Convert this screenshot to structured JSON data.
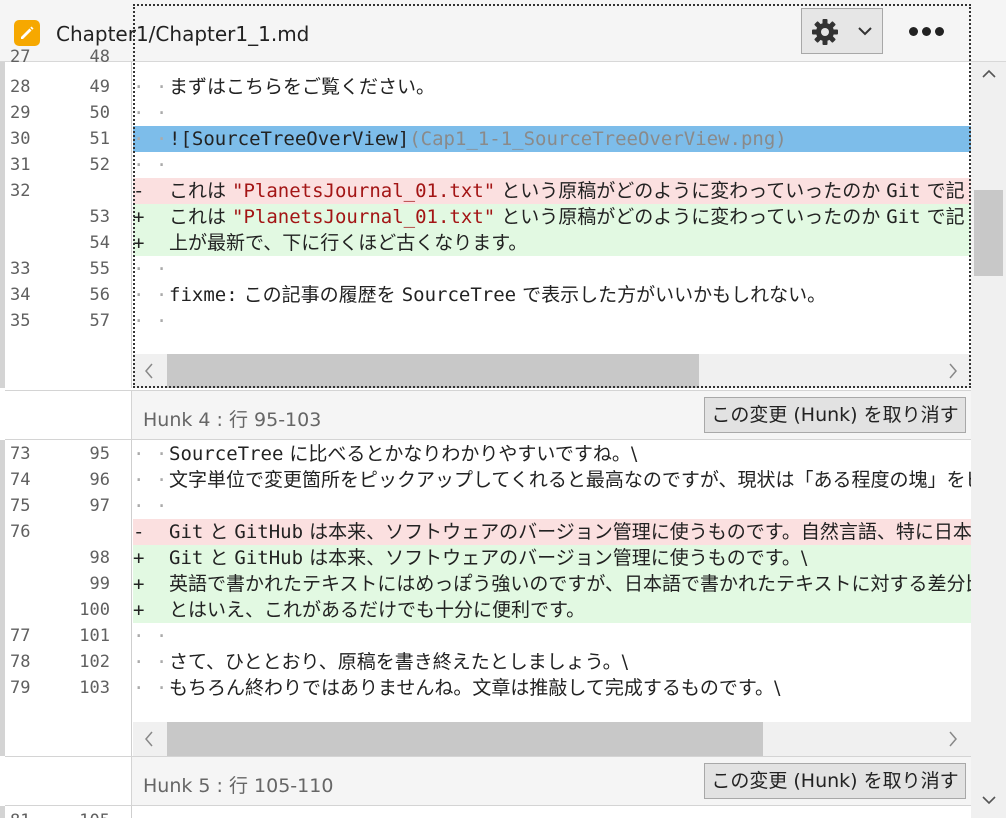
{
  "header": {
    "title": "Chapter1/Chapter1_1.md",
    "file_icon": "pencil-icon",
    "settings_icon": "gear-icon",
    "settings_dropdown_icon": "chevron-down-icon",
    "more_icon": "more-horizontal-icon"
  },
  "colors": {
    "deleted_line": "#fbe0e0",
    "added_line": "#e2f9e2",
    "selected_line": "#7dbdea",
    "file_icon": "#f6a800"
  },
  "hunk1": {
    "partial_top": {
      "old": "27",
      "new": "48"
    },
    "lines": [
      {
        "old": "28",
        "new": "49",
        "marker": "· ·",
        "segments": [
          {
            "t": "まずはこちらをご覧ください。"
          }
        ]
      },
      {
        "old": "29",
        "new": "50",
        "marker": "· ·",
        "segments": []
      },
      {
        "old": "30",
        "new": "51",
        "marker": "· ·",
        "kind": "sel",
        "segments": [
          {
            "t": "![SourceTreeOverView]",
            "c": "mono"
          },
          {
            "t": "(Cap1_1-1_SourceTreeOverView.png)",
            "c": "mono lnk"
          }
        ]
      },
      {
        "old": "31",
        "new": "52",
        "marker": "· ·",
        "segments": []
      },
      {
        "old": "32",
        "new": "",
        "marker": "-",
        "kind": "del",
        "segments": [
          {
            "t": "これは "
          },
          {
            "t": "\"PlanetsJournal_01.txt\"",
            "c": "mono str"
          },
          {
            "t": " という原稿がどのように変わっていったのか "
          },
          {
            "t": "Git",
            "c": "mono"
          },
          {
            "t": " で記"
          }
        ]
      },
      {
        "old": "",
        "new": "53",
        "marker": "+",
        "kind": "add",
        "segments": [
          {
            "t": "これは "
          },
          {
            "t": "\"PlanetsJournal_01.txt\"",
            "c": "mono str"
          },
          {
            "t": " という原稿がどのように変わっていったのか "
          },
          {
            "t": "Git",
            "c": "mono"
          },
          {
            "t": " で記"
          }
        ]
      },
      {
        "old": "",
        "new": "54",
        "marker": "+",
        "kind": "add",
        "segments": [
          {
            "t": "上が最新で、下に行くほど古くなります。"
          }
        ]
      },
      {
        "old": "33",
        "new": "55",
        "marker": "· ·",
        "segments": []
      },
      {
        "old": "34",
        "new": "56",
        "marker": "· ·",
        "segments": [
          {
            "t": "fixme:",
            "c": "mono"
          },
          {
            "t": " この記事の履歴を "
          },
          {
            "t": "SourceTree",
            "c": "mono"
          },
          {
            "t": " で表示した方がいいかもしれない。"
          }
        ]
      },
      {
        "old": "35",
        "new": "57",
        "marker": "· ·",
        "segments": []
      }
    ]
  },
  "hunk4": {
    "label": "Hunk 4 : 行 95-103",
    "revert_label": "この変更 (Hunk) を取り消す",
    "lines": [
      {
        "old": "73",
        "new": "95",
        "marker": "· ·",
        "segments": [
          {
            "t": "SourceTree",
            "c": "mono"
          },
          {
            "t": " に比べるとかなりわかりやすいですね。\\"
          }
        ]
      },
      {
        "old": "74",
        "new": "96",
        "marker": "· ·",
        "segments": [
          {
            "t": "文字単位で変更箇所をピックアップしてくれると最高なのですが、現状は「ある程度の塊」をピッ"
          }
        ]
      },
      {
        "old": "75",
        "new": "97",
        "marker": "· ·",
        "segments": []
      },
      {
        "old": "76",
        "new": "",
        "marker": "-",
        "kind": "del",
        "segments": [
          {
            "t": "Git",
            "c": "mono"
          },
          {
            "t": " と "
          },
          {
            "t": "GitHub",
            "c": "mono"
          },
          {
            "t": " は本来、ソフトウェアのバージョン管理に使うものです。自然言語、特に日本語"
          }
        ]
      },
      {
        "old": "",
        "new": "98",
        "marker": "+",
        "kind": "add",
        "segments": [
          {
            "t": "Git",
            "c": "mono"
          },
          {
            "t": " と "
          },
          {
            "t": "GitHub",
            "c": "mono"
          },
          {
            "t": " は本来、ソフトウェアのバージョン管理に使うものです。\\"
          }
        ]
      },
      {
        "old": "",
        "new": "99",
        "marker": "+",
        "kind": "add",
        "segments": [
          {
            "t": "英語で書かれたテキストにはめっぽう強いのですが、日本語で書かれたテキストに対する差分比較"
          }
        ]
      },
      {
        "old": "",
        "new": "100",
        "marker": "+",
        "kind": "add",
        "segments": [
          {
            "t": "とはいえ、これがあるだけでも十分に便利です。"
          }
        ]
      },
      {
        "old": "77",
        "new": "101",
        "marker": "· ·",
        "segments": []
      },
      {
        "old": "78",
        "new": "102",
        "marker": "· ·",
        "segments": [
          {
            "t": "さて、ひととおり、原稿を書き終えたとしましょう。\\"
          }
        ]
      },
      {
        "old": "79",
        "new": "103",
        "marker": "· ·",
        "segments": [
          {
            "t": "もちろん終わりではありませんね。文章は推敲して完成するものです。\\"
          }
        ]
      }
    ]
  },
  "hunk5": {
    "label": "Hunk 5 : 行 105-110",
    "revert_label": "この変更 (Hunk) を取り消す",
    "partial_bottom": {
      "old": "81",
      "new": "105"
    }
  }
}
